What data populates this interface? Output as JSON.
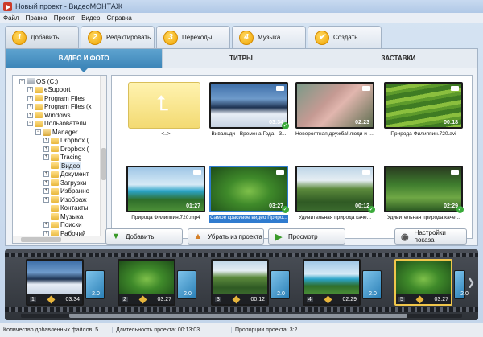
{
  "window": {
    "title": "Новый проект - ВидеоМОНТАЖ",
    "menu": [
      "Файл",
      "Правка",
      "Проект",
      "Видео",
      "Справка"
    ]
  },
  "steps": [
    {
      "num": "1",
      "label": "Добавить",
      "active": true
    },
    {
      "num": "2",
      "label": "Редактировать"
    },
    {
      "num": "3",
      "label": "Переходы"
    },
    {
      "num": "4",
      "label": "Музыка"
    },
    {
      "num": "✔",
      "label": "Создать"
    }
  ],
  "subtabs": [
    "ВИДЕО И ФОТО",
    "ТИТРЫ",
    "ЗАСТАВКИ"
  ],
  "tree": [
    {
      "label": "OS (C:)",
      "level": 0,
      "expander": "−",
      "icon": "drive-icon"
    },
    {
      "label": "eSupport",
      "level": 1,
      "expander": "+",
      "icon": "folder-icon"
    },
    {
      "label": "Program Files",
      "level": 1,
      "expander": "+",
      "icon": "folder-icon"
    },
    {
      "label": "Program Files (x",
      "level": 1,
      "expander": "+",
      "icon": "folder-icon"
    },
    {
      "label": "Windows",
      "level": 1,
      "expander": "+",
      "icon": "folder-icon"
    },
    {
      "label": "Пользователи",
      "level": 1,
      "expander": "−",
      "icon": "folder-icon"
    },
    {
      "label": "Manager",
      "level": 2,
      "expander": "−",
      "icon": "user-icon"
    },
    {
      "label": "Dropbox (",
      "level": 3,
      "expander": "+",
      "icon": "folder-icon"
    },
    {
      "label": "Dropbox (",
      "level": 3,
      "expander": "+",
      "icon": "folder-icon"
    },
    {
      "label": "Tracing",
      "level": 3,
      "expander": "+",
      "icon": "folder-icon"
    },
    {
      "label": "Видео",
      "level": 3,
      "expander": "",
      "icon": "folder-icon",
      "selected": true
    },
    {
      "label": "Документ",
      "level": 3,
      "expander": "+",
      "icon": "folder-icon"
    },
    {
      "label": "Загрузки",
      "level": 3,
      "expander": "+",
      "icon": "folder-icon"
    },
    {
      "label": "Избранно",
      "level": 3,
      "expander": "+",
      "icon": "folder-icon"
    },
    {
      "label": "Изображ",
      "level": 3,
      "expander": "+",
      "icon": "folder-icon"
    },
    {
      "label": "Контакты",
      "level": 3,
      "expander": "",
      "icon": "folder-icon"
    },
    {
      "label": "Музыка",
      "level": 3,
      "expander": "",
      "icon": "folder-icon"
    },
    {
      "label": "Поиски",
      "level": 3,
      "expander": "+",
      "icon": "folder-icon"
    },
    {
      "label": "Рабочий",
      "level": 3,
      "expander": "+",
      "icon": "folder-icon"
    }
  ],
  "thumbnails": [
    {
      "caption": "<..>",
      "kind": "folder",
      "duration": ""
    },
    {
      "caption": "Вивальди - Времена Года - З...",
      "kind": "winter",
      "duration": "03:34",
      "checked": true
    },
    {
      "caption": "Невероятная дружба! люди и д...",
      "kind": "friend",
      "duration": "02:23"
    },
    {
      "caption": "Природа Филиппин.720.avi",
      "kind": "terraces",
      "duration": "00:18"
    },
    {
      "caption": "Природа Филиппин.720.mp4",
      "kind": "coast",
      "duration": "01:27"
    },
    {
      "caption": "Самое красивое видео Приро...",
      "kind": "dragonfly",
      "duration": "03:27",
      "checked": true,
      "selected": true
    },
    {
      "caption": "Удивительная природа каче...",
      "kind": "cliffs",
      "duration": "00:12",
      "checked": true
    },
    {
      "caption": "Удивительная природа каче...",
      "kind": "valley",
      "duration": "02:29",
      "checked": true
    }
  ],
  "buttons": {
    "add": "Добавить",
    "remove": "Убрать из проекта",
    "preview": "Просмотр",
    "settings": "Настройки показа"
  },
  "timeline": {
    "clips": [
      {
        "num": "1",
        "duration": "03:34",
        "kind": "winter"
      },
      {
        "num": "2",
        "duration": "03:27",
        "kind": "dragonfly"
      },
      {
        "num": "3",
        "duration": "00:12",
        "kind": "cliffs"
      },
      {
        "num": "4",
        "duration": "02:29",
        "kind": "coast"
      },
      {
        "num": "5",
        "duration": "03:27",
        "kind": "dragonfly",
        "selected": true
      }
    ],
    "transitions": [
      "2.0",
      "2.0",
      "2.0",
      "2.0",
      "2.0"
    ]
  },
  "status": {
    "files": "Количество добавленных файлов: 5",
    "duration": "Длительность проекта: 00:13:03",
    "ratio": "Пропорции проекта: 3:2"
  }
}
